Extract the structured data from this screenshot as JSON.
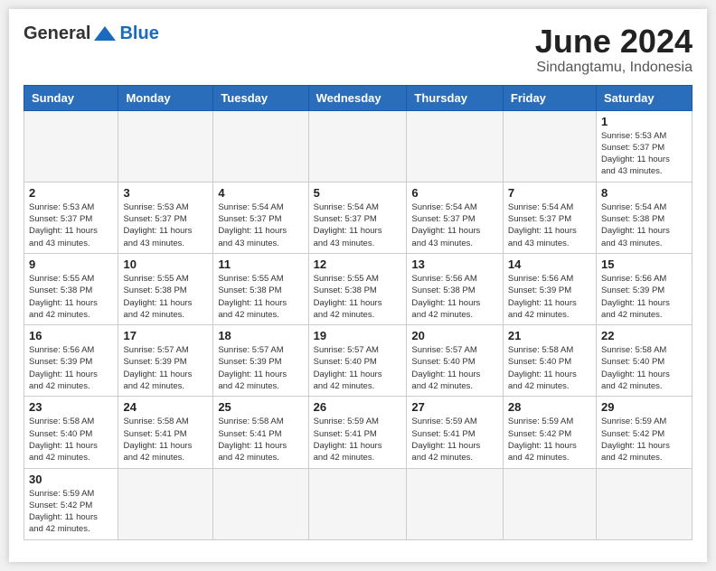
{
  "header": {
    "logo_general": "General",
    "logo_blue": "Blue",
    "title": "June 2024",
    "subtitle": "Sindangtamu, Indonesia"
  },
  "days_of_week": [
    "Sunday",
    "Monday",
    "Tuesday",
    "Wednesday",
    "Thursday",
    "Friday",
    "Saturday"
  ],
  "weeks": [
    [
      {
        "day": "",
        "info": ""
      },
      {
        "day": "",
        "info": ""
      },
      {
        "day": "",
        "info": ""
      },
      {
        "day": "",
        "info": ""
      },
      {
        "day": "",
        "info": ""
      },
      {
        "day": "",
        "info": ""
      },
      {
        "day": "1",
        "info": "Sunrise: 5:53 AM\nSunset: 5:37 PM\nDaylight: 11 hours\nand 43 minutes."
      }
    ],
    [
      {
        "day": "2",
        "info": "Sunrise: 5:53 AM\nSunset: 5:37 PM\nDaylight: 11 hours\nand 43 minutes."
      },
      {
        "day": "3",
        "info": "Sunrise: 5:53 AM\nSunset: 5:37 PM\nDaylight: 11 hours\nand 43 minutes."
      },
      {
        "day": "4",
        "info": "Sunrise: 5:54 AM\nSunset: 5:37 PM\nDaylight: 11 hours\nand 43 minutes."
      },
      {
        "day": "5",
        "info": "Sunrise: 5:54 AM\nSunset: 5:37 PM\nDaylight: 11 hours\nand 43 minutes."
      },
      {
        "day": "6",
        "info": "Sunrise: 5:54 AM\nSunset: 5:37 PM\nDaylight: 11 hours\nand 43 minutes."
      },
      {
        "day": "7",
        "info": "Sunrise: 5:54 AM\nSunset: 5:37 PM\nDaylight: 11 hours\nand 43 minutes."
      },
      {
        "day": "8",
        "info": "Sunrise: 5:54 AM\nSunset: 5:38 PM\nDaylight: 11 hours\nand 43 minutes."
      }
    ],
    [
      {
        "day": "9",
        "info": "Sunrise: 5:55 AM\nSunset: 5:38 PM\nDaylight: 11 hours\nand 42 minutes."
      },
      {
        "day": "10",
        "info": "Sunrise: 5:55 AM\nSunset: 5:38 PM\nDaylight: 11 hours\nand 42 minutes."
      },
      {
        "day": "11",
        "info": "Sunrise: 5:55 AM\nSunset: 5:38 PM\nDaylight: 11 hours\nand 42 minutes."
      },
      {
        "day": "12",
        "info": "Sunrise: 5:55 AM\nSunset: 5:38 PM\nDaylight: 11 hours\nand 42 minutes."
      },
      {
        "day": "13",
        "info": "Sunrise: 5:56 AM\nSunset: 5:38 PM\nDaylight: 11 hours\nand 42 minutes."
      },
      {
        "day": "14",
        "info": "Sunrise: 5:56 AM\nSunset: 5:39 PM\nDaylight: 11 hours\nand 42 minutes."
      },
      {
        "day": "15",
        "info": "Sunrise: 5:56 AM\nSunset: 5:39 PM\nDaylight: 11 hours\nand 42 minutes."
      }
    ],
    [
      {
        "day": "16",
        "info": "Sunrise: 5:56 AM\nSunset: 5:39 PM\nDaylight: 11 hours\nand 42 minutes."
      },
      {
        "day": "17",
        "info": "Sunrise: 5:57 AM\nSunset: 5:39 PM\nDaylight: 11 hours\nand 42 minutes."
      },
      {
        "day": "18",
        "info": "Sunrise: 5:57 AM\nSunset: 5:39 PM\nDaylight: 11 hours\nand 42 minutes."
      },
      {
        "day": "19",
        "info": "Sunrise: 5:57 AM\nSunset: 5:40 PM\nDaylight: 11 hours\nand 42 minutes."
      },
      {
        "day": "20",
        "info": "Sunrise: 5:57 AM\nSunset: 5:40 PM\nDaylight: 11 hours\nand 42 minutes."
      },
      {
        "day": "21",
        "info": "Sunrise: 5:58 AM\nSunset: 5:40 PM\nDaylight: 11 hours\nand 42 minutes."
      },
      {
        "day": "22",
        "info": "Sunrise: 5:58 AM\nSunset: 5:40 PM\nDaylight: 11 hours\nand 42 minutes."
      }
    ],
    [
      {
        "day": "23",
        "info": "Sunrise: 5:58 AM\nSunset: 5:40 PM\nDaylight: 11 hours\nand 42 minutes."
      },
      {
        "day": "24",
        "info": "Sunrise: 5:58 AM\nSunset: 5:41 PM\nDaylight: 11 hours\nand 42 minutes."
      },
      {
        "day": "25",
        "info": "Sunrise: 5:58 AM\nSunset: 5:41 PM\nDaylight: 11 hours\nand 42 minutes."
      },
      {
        "day": "26",
        "info": "Sunrise: 5:59 AM\nSunset: 5:41 PM\nDaylight: 11 hours\nand 42 minutes."
      },
      {
        "day": "27",
        "info": "Sunrise: 5:59 AM\nSunset: 5:41 PM\nDaylight: 11 hours\nand 42 minutes."
      },
      {
        "day": "28",
        "info": "Sunrise: 5:59 AM\nSunset: 5:42 PM\nDaylight: 11 hours\nand 42 minutes."
      },
      {
        "day": "29",
        "info": "Sunrise: 5:59 AM\nSunset: 5:42 PM\nDaylight: 11 hours\nand 42 minutes."
      }
    ],
    [
      {
        "day": "30",
        "info": "Sunrise: 5:59 AM\nSunset: 5:42 PM\nDaylight: 11 hours\nand 42 minutes."
      },
      {
        "day": "",
        "info": ""
      },
      {
        "day": "",
        "info": ""
      },
      {
        "day": "",
        "info": ""
      },
      {
        "day": "",
        "info": ""
      },
      {
        "day": "",
        "info": ""
      },
      {
        "day": "",
        "info": ""
      }
    ]
  ]
}
